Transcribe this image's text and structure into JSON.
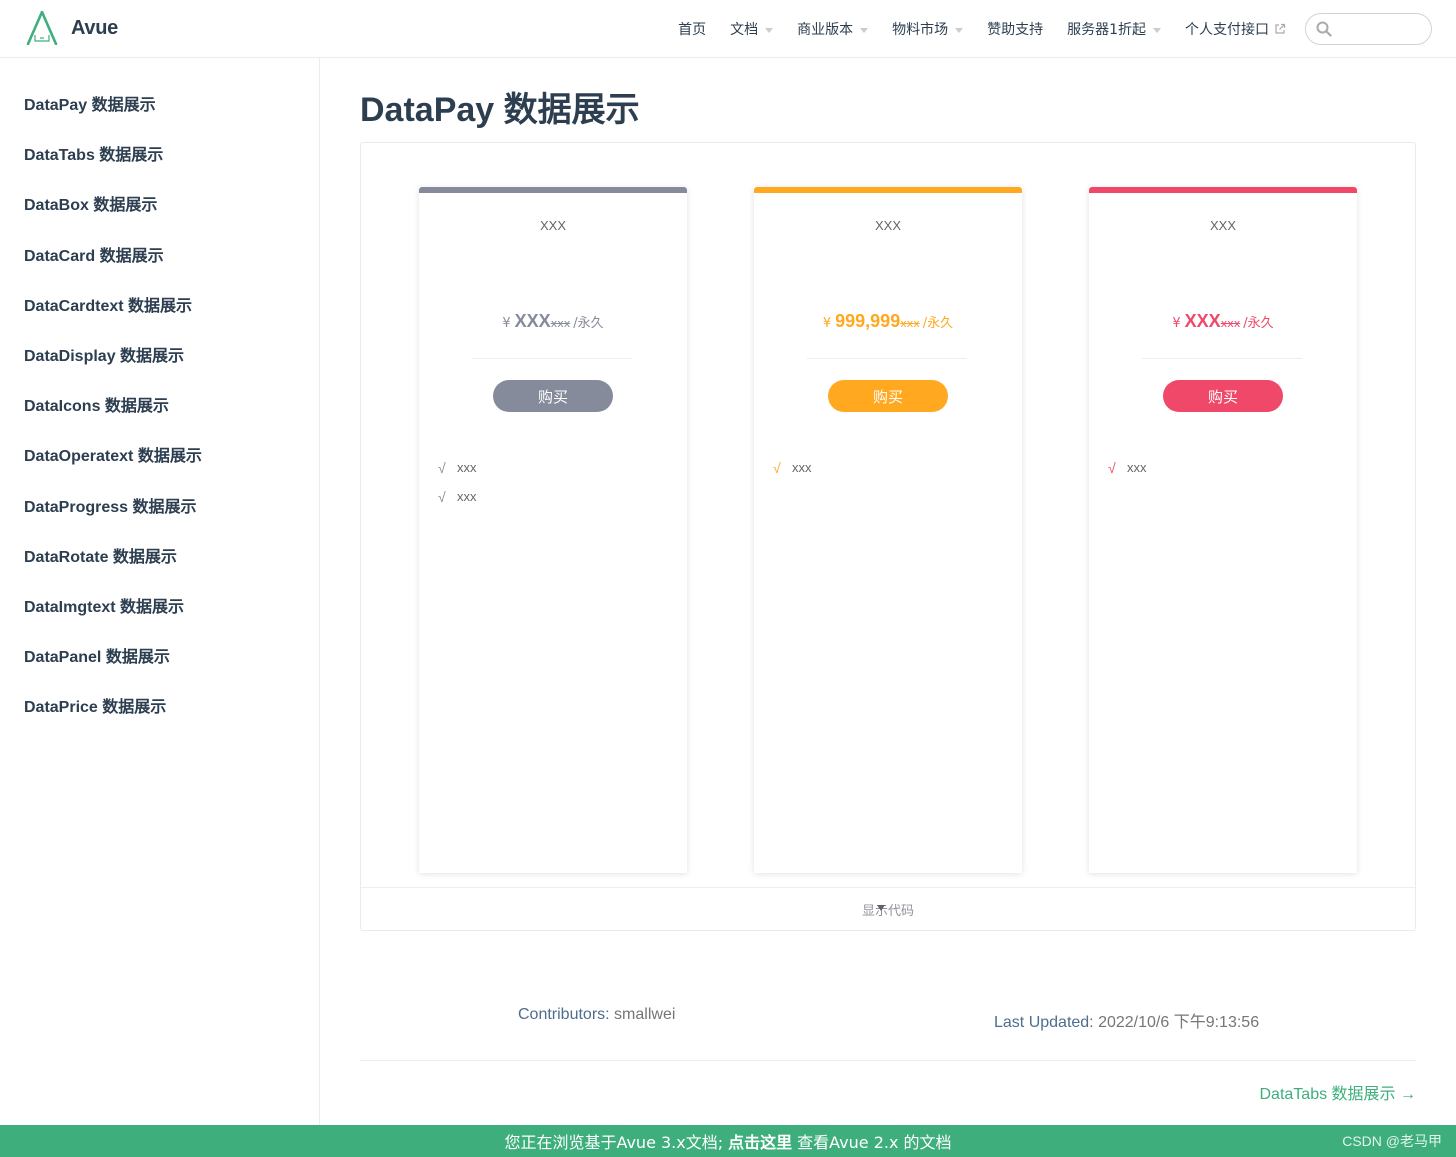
{
  "header": {
    "site_name": "Avue",
    "nav": [
      {
        "label": "首页",
        "dropdown": false
      },
      {
        "label": "文档",
        "dropdown": true
      },
      {
        "label": "商业版本",
        "dropdown": true
      },
      {
        "label": "物料市场",
        "dropdown": true
      },
      {
        "label": "赞助支持",
        "dropdown": false
      },
      {
        "label": "服务器1折起",
        "dropdown": true
      },
      {
        "label": "个人支付接口",
        "dropdown": false,
        "external": true
      }
    ],
    "search_placeholder": ""
  },
  "sidebar": {
    "items": [
      {
        "label": "DataPay 数据展示"
      },
      {
        "label": "DataTabs 数据展示"
      },
      {
        "label": "DataBox 数据展示"
      },
      {
        "label": "DataCard 数据展示"
      },
      {
        "label": "DataCardtext 数据展示"
      },
      {
        "label": "DataDisplay 数据展示"
      },
      {
        "label": "DataIcons 数据展示"
      },
      {
        "label": "DataOperatext 数据展示"
      },
      {
        "label": "DataProgress 数据展示"
      },
      {
        "label": "DataRotate 数据展示"
      },
      {
        "label": "DataImgtext 数据展示"
      },
      {
        "label": "DataPanel 数据展示"
      },
      {
        "label": "DataPrice 数据展示"
      }
    ]
  },
  "main": {
    "title": "DataPay 数据展示",
    "cards": [
      {
        "title": "XXX",
        "currency": "¥",
        "amount": "XXX",
        "orig": "xxx",
        "unit": "/永久",
        "button": "购买",
        "color": "#868b9b",
        "features": [
          {
            "check": "√",
            "text": "xxx"
          },
          {
            "check": "√",
            "text": "xxx"
          }
        ]
      },
      {
        "title": "XXX",
        "currency": "¥",
        "amount": "999,999",
        "orig": "xxx",
        "unit": "/永久",
        "button": "购买",
        "color": "#ffa820",
        "features": [
          {
            "check": "√",
            "text": "xxx"
          }
        ]
      },
      {
        "title": "XXX",
        "currency": "¥",
        "amount": "XXX",
        "orig": "xxx",
        "unit": "/永久",
        "button": "购买",
        "color": "#ef4868",
        "features": [
          {
            "check": "√",
            "text": "xxx"
          }
        ]
      }
    ],
    "show_code": "显示代码"
  },
  "meta": {
    "contributors_label": "Contributors:",
    "contributors_value": "smallwei",
    "last_updated_label": "Last Updated:",
    "last_updated_value": "2022/10/6 下午9:13:56"
  },
  "next_link": "DataTabs 数据展示 →",
  "banner": {
    "prefix": "您正在浏览基于Avue 3.x文档;",
    "link": "点击这里",
    "suffix": "查看Avue 2.x 的文档"
  },
  "watermark": "CSDN @老马甲"
}
